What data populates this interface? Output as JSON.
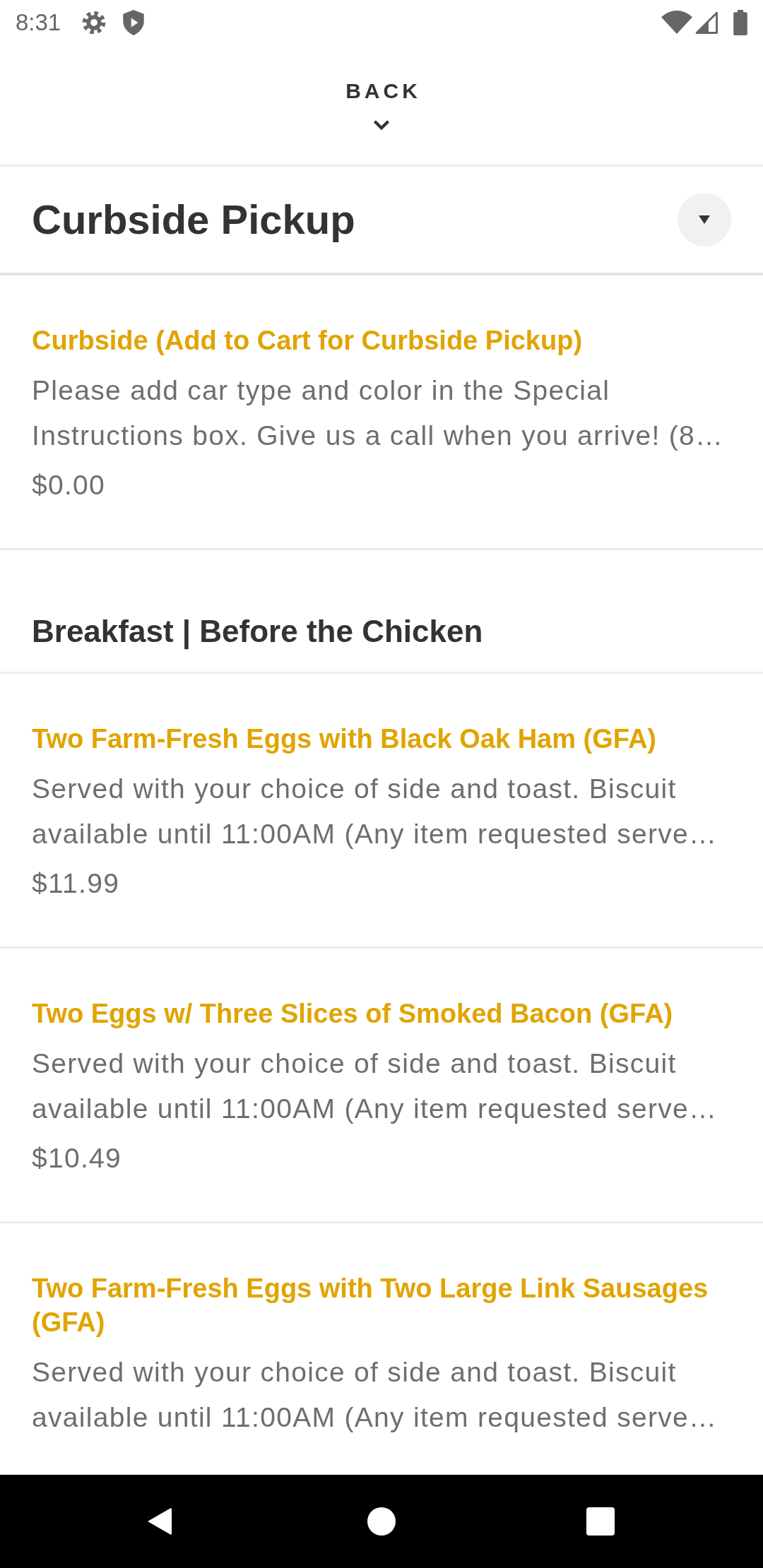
{
  "status_bar": {
    "time": "8:31"
  },
  "header": {
    "back_label": "BACK"
  },
  "sections": [
    {
      "kind": "category",
      "title": "Curbside Pickup",
      "items": [
        {
          "name": "Curbside (Add to Cart for Curbside Pickup)",
          "description_lines": [
            "Please add car type and color in the Special",
            "Instructions box. Give us a call when you arrive! (8…"
          ],
          "price": "$0.00"
        }
      ]
    },
    {
      "kind": "group",
      "title": "Breakfast | Before the Chicken",
      "items": [
        {
          "name": "Two Farm-Fresh Eggs with Black Oak Ham (GFA)",
          "description_lines": [
            "Served with your choice of side and toast. Biscuit",
            "available until 11:00AM (Any item requested serve…"
          ],
          "price": "$11.99"
        },
        {
          "name": "Two Eggs w/ Three Slices of Smoked Bacon (GFA)",
          "description_lines": [
            "Served with your choice of side and toast. Biscuit",
            "available until 11:00AM (Any item requested serve…"
          ],
          "price": "$10.49"
        },
        {
          "name": "Two Farm-Fresh Eggs with Two Large Link Sausages (GFA)",
          "description_lines": [
            "Served with your choice of side and toast. Biscuit",
            "available until 11:00AM (Any item requested serve…"
          ]
        }
      ]
    }
  ]
}
